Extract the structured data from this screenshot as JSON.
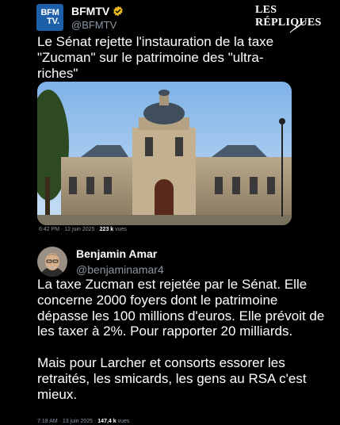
{
  "watermark": {
    "brand": "LES RÉPLIQUES"
  },
  "tweet1": {
    "avatar_text_line1": "BFM",
    "avatar_text_line2": "TV.",
    "name": "BFMTV",
    "verified_color": "#e8b923",
    "handle": "@BFMTV",
    "text": "Le Sénat rejette l'instauration de la taxe \"Zucman\" sur le patrimoine des \"ultra-riches\"",
    "image": "senate-building-photo",
    "time": "6:42 PM · 12 juin 2025 · ",
    "views_count": "223 k",
    "views_label": " vues"
  },
  "tweet2": {
    "name": "Benjamin Amar",
    "handle": "@benjaminamar4",
    "paragraph1": "La taxe Zucman est rejetée par le Sénat. Elle concerne 2000 foyers dont le patrimoine dépasse les 100 millions d'euros. Elle prévoit de les taxer à 2%. Pour rapporter 20 milliards.",
    "paragraph2": "Mais pour Larcher et consorts essorer les retraités, les smicards, les gens au RSA c'est mieux.",
    "time": "7:18 AM · 13 juin 2025 · ",
    "views_count": "147,4 k",
    "views_label": " vues"
  }
}
